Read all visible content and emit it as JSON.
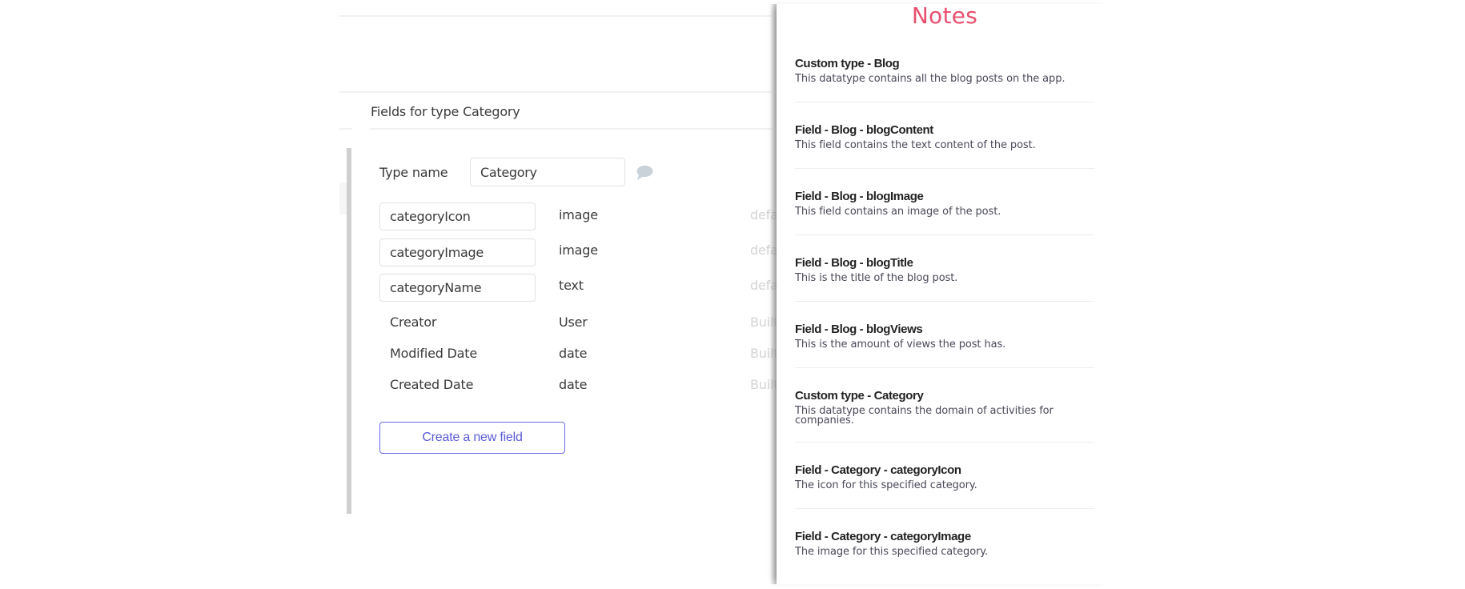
{
  "editor": {
    "section_title": "Fields for type Category",
    "type_name_label": "Type name",
    "type_name_value": "Category",
    "comment_icon": "speech-bubble-icon",
    "custom_fields": [
      {
        "name": "categoryIcon",
        "type": "image",
        "default": "default"
      },
      {
        "name": "categoryImage",
        "type": "image",
        "default": "default"
      },
      {
        "name": "categoryName",
        "type": "text",
        "default": "default"
      }
    ],
    "builtin_fields": [
      {
        "name": "Creator",
        "type": "User",
        "note": "Built-in"
      },
      {
        "name": "Modified Date",
        "type": "date",
        "note": "Built-in"
      },
      {
        "name": "Created Date",
        "type": "date",
        "note": "Built-in"
      }
    ],
    "create_button_label": "Create a new field"
  },
  "notes": {
    "title": "Notes",
    "title_color": "#e8506f",
    "items": [
      {
        "heading": "Custom type - Blog",
        "description": "This datatype contains all the blog posts on the app."
      },
      {
        "heading": "Field - Blog - blogContent",
        "description": "This field contains the text content of the post."
      },
      {
        "heading": "Field - Blog - blogImage",
        "description": "This field contains an image of the post."
      },
      {
        "heading": "Field - Blog - blogTitle",
        "description": "This is the title of the blog post."
      },
      {
        "heading": "Field - Blog - blogViews",
        "description": "This is the amount of views the post has."
      },
      {
        "heading": "Custom type - Category",
        "description": "This datatype contains the domain of activities for companies."
      },
      {
        "heading": "Field - Category - categoryIcon",
        "description": "The icon for this specified category."
      },
      {
        "heading": "Field - Category - categoryImage",
        "description": "The image for this specified category."
      }
    ]
  },
  "colors": {
    "accent": "#5a5ad6",
    "button_border": "#6b6be6"
  }
}
